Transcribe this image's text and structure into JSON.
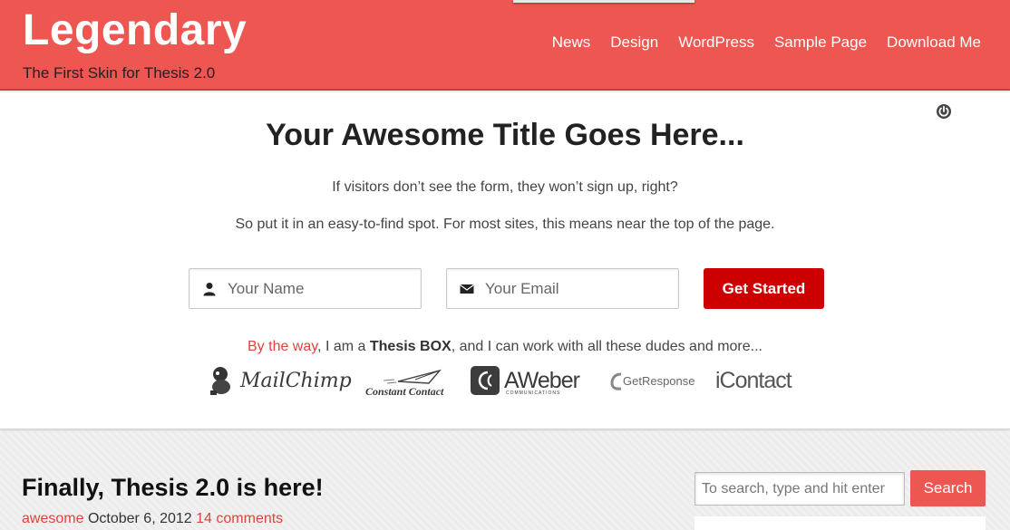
{
  "header": {
    "site_title": "Legendary",
    "tagline": "The First Skin for Thesis 2.0",
    "nav": [
      "News",
      "Design",
      "WordPress",
      "Sample Page",
      "Download Me"
    ]
  },
  "optin": {
    "title": "Your Awesome Title Goes Here...",
    "paragraph_1": "If visitors don’t see the form, they won’t sign up, right?",
    "paragraph_2": "So put it in an easy-to-find spot. For most sites, this means near the top of the page.",
    "name_placeholder": "Your Name",
    "email_placeholder": "Your Email",
    "submit_label": "Get Started",
    "works_prefix": "By the way",
    "works_mid": ", I am a ",
    "works_bold": "Thesis BOX",
    "works_suffix": ", and I can work with all these dudes and more...",
    "logos": {
      "mailchimp": "MailChimp",
      "constant_contact": "Constant Contact",
      "aweber": "AWeber",
      "aweber_sub": "COMMUNICATIONS",
      "getresponse": "GetResponse",
      "icontact": "iContact"
    }
  },
  "post": {
    "title": "Finally, Thesis 2.0 is here!",
    "category": "awesome",
    "date": "October 6, 2012",
    "comments": "14 comments"
  },
  "sidebar": {
    "search_placeholder": "To search, type and hit enter",
    "search_button": "Search"
  },
  "colors": {
    "brand": "#ed5651",
    "button_red": "#cc0000",
    "link_red": "#e2413c"
  }
}
